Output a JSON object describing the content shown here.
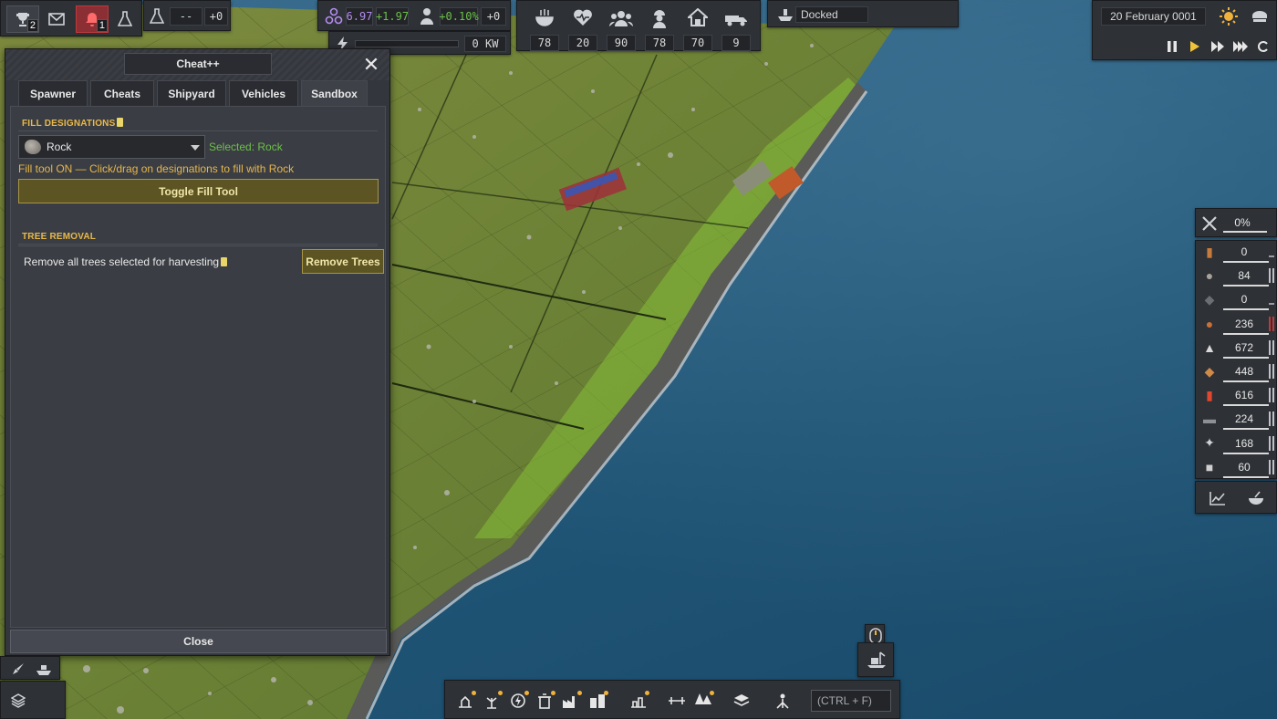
{
  "top_left": {
    "trophy_badge": "2",
    "alert_badge": "1",
    "research_value": "--",
    "research_delta": "+0"
  },
  "stats": {
    "unity_value": "6.97",
    "unity_delta": "+1.97",
    "pop_growth": "+0.10%",
    "pop_delta": "+0",
    "power_value": "0 KW"
  },
  "population": {
    "food": "78",
    "health": "20",
    "people": "90",
    "workers": "78",
    "housing": "70",
    "vehicles": "9"
  },
  "ship_status": "Docked",
  "date": "20 February 0001",
  "dialog": {
    "title": "Cheat++",
    "tabs": [
      "Spawner",
      "Cheats",
      "Shipyard",
      "Vehicles",
      "Sandbox"
    ],
    "active_tab": "Sandbox",
    "fill_section": "FILL DESIGNATIONS",
    "selected_material": "Rock",
    "selected_text": "Selected: Rock",
    "fill_status": "Fill tool ON — Click/drag on designations to fill with Rock",
    "toggle_label": "Toggle Fill Tool",
    "tree_section": "TREE REMOVAL",
    "tree_text": "Remove all trees selected for harvesting",
    "remove_label": "Remove Trees",
    "close_label": "Close"
  },
  "resources": {
    "maintenance": "0%",
    "items": [
      {
        "name": "wood-icon",
        "value": "0",
        "bar": "dash"
      },
      {
        "name": "rock-icon",
        "value": "84",
        "bar": "gray"
      },
      {
        "name": "slag-icon",
        "value": "0",
        "bar": "dash"
      },
      {
        "name": "copper-ore-icon",
        "value": "236",
        "bar": "red"
      },
      {
        "name": "construction-parts-icon",
        "value": "672",
        "bar": "gray"
      },
      {
        "name": "planks-icon",
        "value": "448",
        "bar": "gray"
      },
      {
        "name": "diesel-icon",
        "value": "616",
        "bar": "gray"
      },
      {
        "name": "iron-icon",
        "value": "224",
        "bar": "gray"
      },
      {
        "name": "mechanical-parts-icon",
        "value": "168",
        "bar": "gray"
      },
      {
        "name": "concrete-icon",
        "value": "60",
        "bar": "gray"
      }
    ]
  },
  "search": {
    "placeholder": "(CTRL + F)"
  },
  "colors": {
    "accent": "#e9b949",
    "selected_green": "#6cc04a",
    "button_gold": "#5d5424",
    "alert_red": "#c0393b",
    "pop_green": "#6cc04a",
    "unity_purple": "#b58cf0"
  }
}
